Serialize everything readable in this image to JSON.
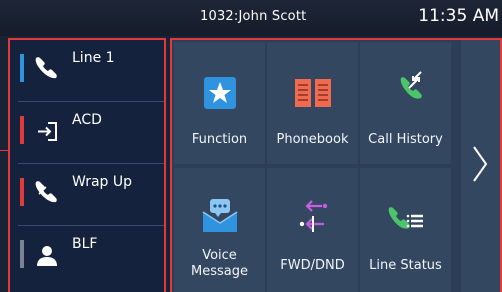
{
  "status": {
    "user": "1032:John Scott",
    "time": "11:35 AM"
  },
  "accounts": [
    {
      "label": "Line 1",
      "icon": "handset-icon",
      "status_color": "#2f93e0"
    },
    {
      "label": "ACD",
      "icon": "login-arrow-icon",
      "status_color": "#e03a3a"
    },
    {
      "label": "Wrap Up",
      "icon": "handset-wrapup-icon",
      "status_color": "#e03a3a"
    },
    {
      "label": "BLF",
      "icon": "person-icon",
      "status_color": "#7a8393"
    }
  ],
  "menu": [
    {
      "label": "Function",
      "icon": "star-icon"
    },
    {
      "label": "Phonebook",
      "icon": "book-icon"
    },
    {
      "label": "Call History",
      "icon": "call-history-icon"
    },
    {
      "label": "Voice Message",
      "label_line1": "Voice",
      "label_line2": "Message",
      "icon": "voicemail-icon"
    },
    {
      "label": "FWD/DND",
      "icon": "forward-dnd-icon"
    },
    {
      "label": "Line Status",
      "icon": "line-status-icon"
    }
  ],
  "colors": {
    "highlight": "#e23a3a",
    "blue": "#2f93e0",
    "green": "#4cc46a",
    "orange": "#ef6a4e",
    "violet": "#c55fe0"
  }
}
